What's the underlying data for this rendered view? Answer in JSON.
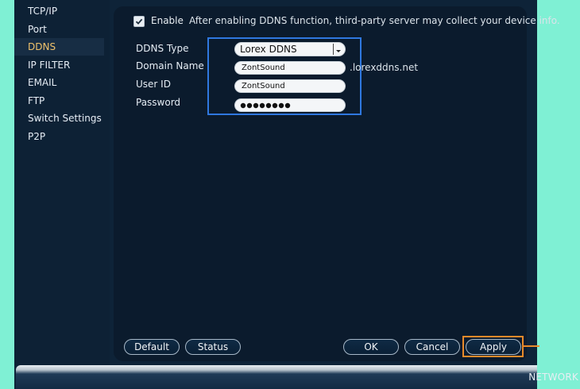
{
  "sidebar": {
    "items": [
      {
        "label": "TCP/IP",
        "active": false
      },
      {
        "label": "Port",
        "active": false
      },
      {
        "label": "DDNS",
        "active": true
      },
      {
        "label": "IP FILTER",
        "active": false
      },
      {
        "label": "EMAIL",
        "active": false
      },
      {
        "label": "FTP",
        "active": false
      },
      {
        "label": "Switch Settings",
        "active": false
      },
      {
        "label": "P2P",
        "active": false
      }
    ]
  },
  "ddns": {
    "enable_label": "Enable",
    "enabled": true,
    "enable_note": "After enabling DDNS function, third-party server may collect your device info.",
    "type_label": "DDNS Type",
    "type_value": "Lorex DDNS",
    "domain_label": "Domain Name",
    "domain_value": "ZontSound",
    "domain_suffix": ".lorexddns.net",
    "userid_label": "User ID",
    "userid_value": "ZontSound",
    "password_label": "Password",
    "password_length": 8
  },
  "buttons": {
    "default": "Default",
    "status": "Status",
    "ok": "OK",
    "cancel": "Cancel",
    "apply": "Apply"
  },
  "footer": {
    "section": "NETWORK"
  },
  "colors": {
    "active_item": "#f0c26b",
    "highlight_blue": "#2f78e0",
    "highlight_orange": "#e98a2a"
  }
}
